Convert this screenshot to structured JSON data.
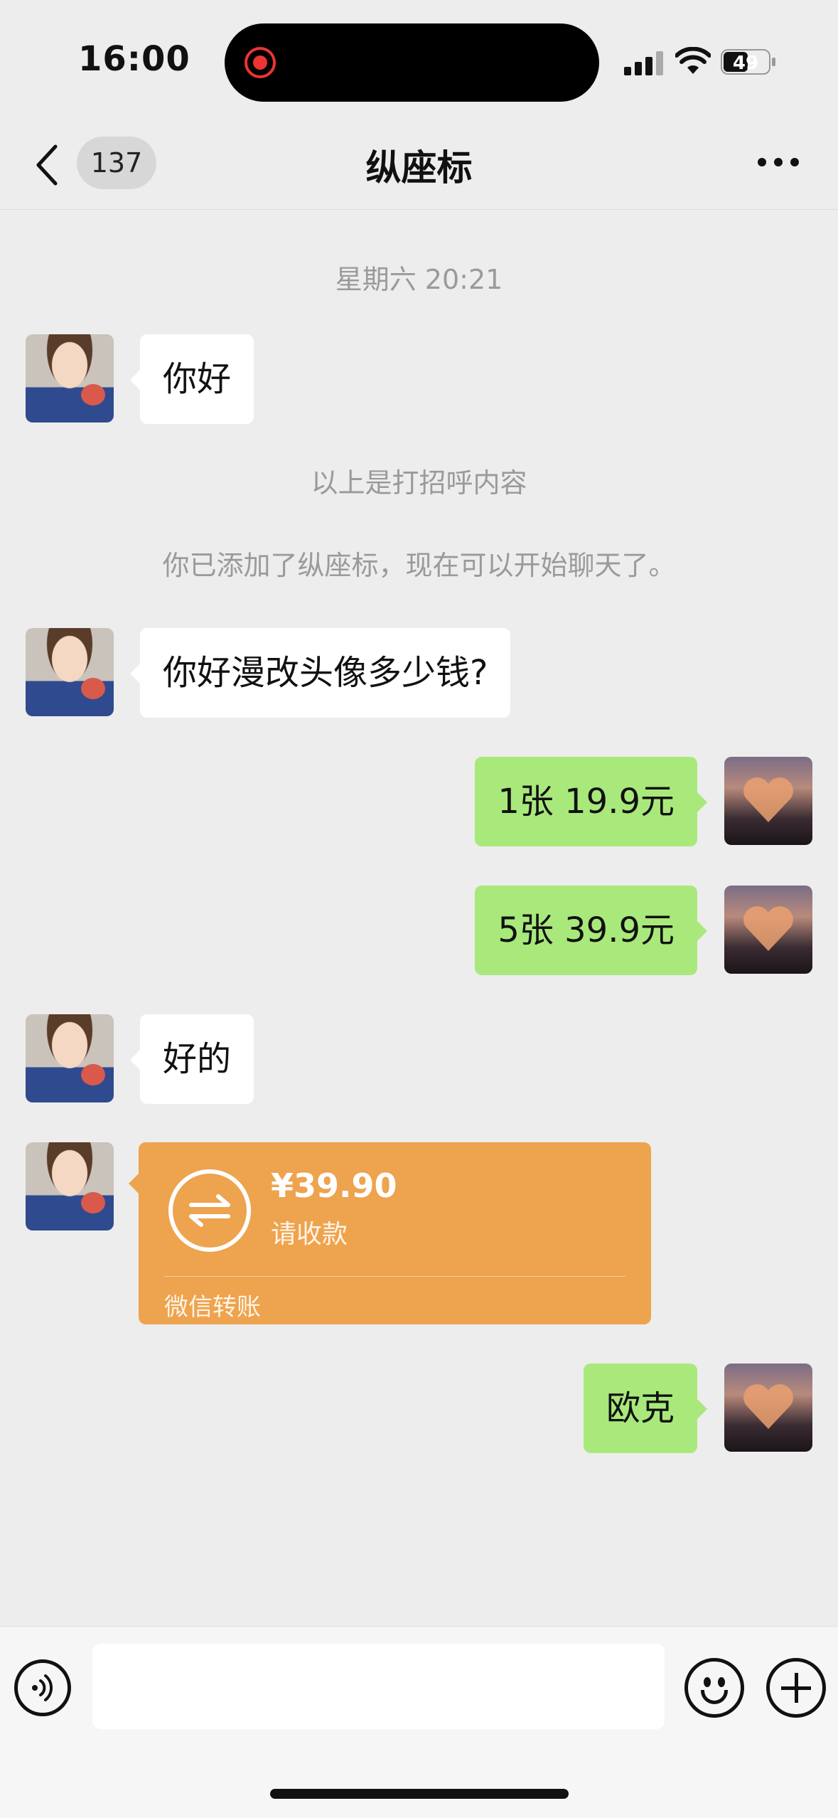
{
  "status_bar": {
    "time": "16:00",
    "battery": "49",
    "icons": [
      "screen-recording-icon",
      "cellular-signal-icon",
      "wifi-icon",
      "battery-icon"
    ]
  },
  "header": {
    "back_icon": "chevron-left-icon",
    "unread_count": "137",
    "title": "纵座标",
    "more_icon": "more-dots-icon"
  },
  "messages": [
    {
      "type": "system",
      "text": "星期六 20:21"
    },
    {
      "type": "incoming",
      "text": "你好"
    },
    {
      "type": "system",
      "text": "以上是打招呼内容"
    },
    {
      "type": "system",
      "text": "你已添加了纵座标，现在可以开始聊天了。"
    },
    {
      "type": "incoming",
      "text": "你好漫改头像多少钱?"
    },
    {
      "type": "outgoing",
      "text": "1张 19.9元"
    },
    {
      "type": "outgoing",
      "text": "5张 39.9元"
    },
    {
      "type": "incoming",
      "text": "好的"
    },
    {
      "type": "transfer",
      "amount": "¥39.90",
      "status": "请收款",
      "label": "微信转账"
    },
    {
      "type": "outgoing",
      "text": "欧克"
    }
  ],
  "input_bar": {
    "voice_icon": "voice-icon",
    "placeholder": "",
    "emoji_icon": "emoji-icon",
    "plus_icon": "plus-icon"
  },
  "colors": {
    "background": "#ededed",
    "outgoing_bubble": "#a9e97c",
    "incoming_bubble": "#ffffff",
    "transfer_card": "#eea34e"
  }
}
